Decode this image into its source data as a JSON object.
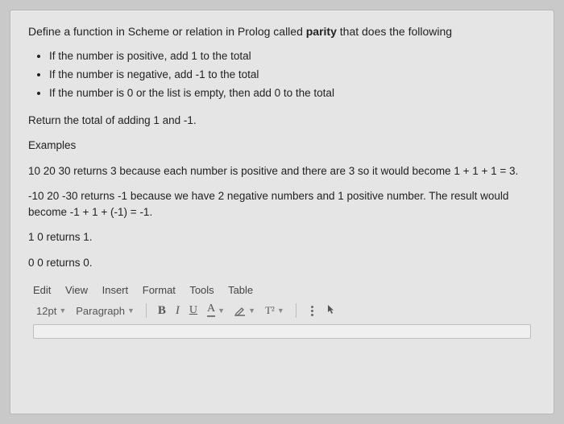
{
  "question": {
    "intro_pre": "Define a function in Scheme or relation in Prolog called ",
    "intro_bold": "parity",
    "intro_post": " that does the following",
    "rules": [
      "If the number is positive, add 1 to the total",
      "If the number is negative, add -1 to the total",
      "If the number is 0 or the list is empty, then add 0 to the total"
    ],
    "return": "Return the total of adding 1 and -1.",
    "examples_label": "Examples",
    "ex1": "10 20 30 returns 3 because each number is positive and there are 3 so it would become 1 + 1 + 1 = 3.",
    "ex2": "-10 20 -30 returns -1 because we have 2 negative numbers and 1 positive number.  The result would become -1 + 1 + (-1) = -1.",
    "ex3": "1 0 returns 1.",
    "ex4": "0 0 returns 0."
  },
  "editor": {
    "menus": [
      "Edit",
      "View",
      "Insert",
      "Format",
      "Tools",
      "Table"
    ],
    "font_size": "12pt",
    "block_format": "Paragraph",
    "buttons": {
      "bold": "B",
      "italic": "I",
      "underline": "U",
      "textcolor": "A",
      "superscript": "T²"
    }
  }
}
